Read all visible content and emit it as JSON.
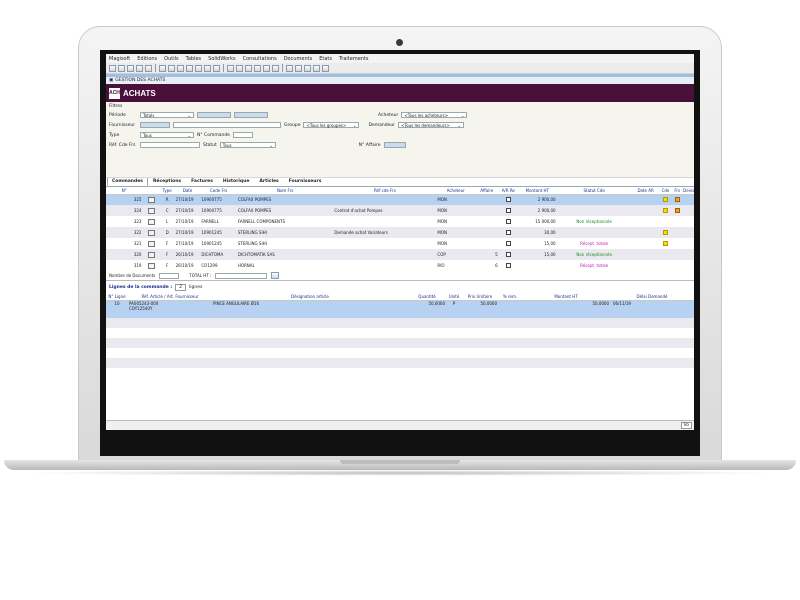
{
  "menu": [
    "Magisoft",
    "Editions",
    "Outils",
    "Tables",
    "SolidWorks",
    "Consultations",
    "Documents",
    "Etats",
    "Traitements"
  ],
  "subbar": {
    "path": "GESTION DES ACHATS"
  },
  "header": {
    "title": "ACHATS",
    "logo": "ACH"
  },
  "filters": {
    "section_label": "Filtres",
    "periode_label": "Période",
    "periode_value": "Totals",
    "fournisseur_label": "Fournisseur",
    "groupe_label": "Groupe",
    "groupe_value": "<Tous les groupes>",
    "acheteur_label": "Acheteur",
    "acheteur_value": "<Tous les acheteurs>",
    "demandeur_label": "Demandeur",
    "demandeur_value": "<Tous les demandeurs>",
    "type_label": "Type",
    "type_value": "Tous",
    "ncommande_label": "N° Commande",
    "refcde_label": "Réf. Cde Frs",
    "statut_label": "Statut",
    "statut_value": "Tous",
    "affaire_label": "N° Affaire"
  },
  "tabs": [
    "Commandes",
    "Réceptions",
    "Factures",
    "Historique",
    "Articles",
    "Fournisseurs"
  ],
  "orders": {
    "columns": [
      "N°",
      "",
      "Type",
      "Date",
      "Code Frs",
      "Nom Frs",
      "Réf cde Frs",
      "Acheteur",
      "Affaire",
      "A/R Re",
      "Montant HT",
      "Statut Cde",
      "Date AR",
      "Cde",
      "Frs",
      "Devis"
    ],
    "rows": [
      {
        "num": "325",
        "type": "R",
        "date": "27/10/19",
        "code": "10900775",
        "nom": "COLFAX POMPES",
        "ref": "",
        "acheteur": "MON",
        "affaire": "",
        "montant": "2 900,00",
        "statut": "",
        "statut_class": "",
        "cde": "y",
        "frs": "o"
      },
      {
        "num": "324",
        "type": "C",
        "date": "27/10/19",
        "code": "10900775",
        "nom": "COLFAX POMPES",
        "ref": "Contrat d'achat Pompes",
        "acheteur": "MON",
        "affaire": "",
        "montant": "2 900,00",
        "statut": "",
        "statut_class": "",
        "cde": "y",
        "frs": "o"
      },
      {
        "num": "323",
        "type": "L",
        "date": "27/10/19",
        "code": "FARNELL",
        "nom": "FARNELL COMPONENTS",
        "ref": "",
        "acheteur": "MON",
        "affaire": "",
        "montant": "15 000,00",
        "statut": "Non réceptionnée",
        "statut_class": "green",
        "cde": "",
        "frs": ""
      },
      {
        "num": "322",
        "type": "D",
        "date": "27/10/19",
        "code": "10901245",
        "nom": "STERLING SIHI",
        "ref": "Demande achat Variateurs",
        "acheteur": "MON",
        "affaire": "",
        "montant": "30,00",
        "statut": "",
        "statut_class": "",
        "cde": "y",
        "frs": ""
      },
      {
        "num": "321",
        "type": "F",
        "date": "27/10/19",
        "code": "10901245",
        "nom": "STERLING SIHI",
        "ref": "",
        "acheteur": "MON",
        "affaire": "",
        "montant": "15,00",
        "statut": "Récept. totale",
        "statut_class": "magenta",
        "cde": "y",
        "frs": ""
      },
      {
        "num": "320",
        "type": "F",
        "date": "26/10/19",
        "code": "DICHTOMA",
        "nom": "DICHTOMATIK SAS",
        "ref": "",
        "acheteur": "COP",
        "affaire": "5",
        "montant": "15,00",
        "statut": "Non réceptionnée",
        "statut_class": "green",
        "cde": "",
        "frs": ""
      },
      {
        "num": "319",
        "type": "F",
        "date": "26/10/19",
        "code": "CO1299",
        "nom": "HORNAL",
        "ref": "",
        "acheteur": "RIO",
        "affaire": "6",
        "montant": "",
        "statut": "Récept. totale",
        "statut_class": "magenta",
        "cde": "",
        "frs": ""
      }
    ]
  },
  "totals": {
    "nombre_label": "Nombre de Documents",
    "total_label": "TOTAL HT :"
  },
  "lignes": {
    "title": "Lignes de la commande :",
    "count": "2",
    "count_suffix": "lignes",
    "columns": [
      "N° Ligne",
      "Réf. Article / Art. Fournisseur",
      "Désignation article",
      "Quantité",
      "Unité",
      "Prix Unitaire",
      "% rem.",
      "Montant HT",
      "Délai Demandé"
    ],
    "rows": [
      {
        "n": "10",
        "ref": "PA005243-000",
        "ref2": "COY12540Y",
        "design": "PINCE ANGULAIRE Ø16",
        "qte": "50,0000",
        "unite": "P",
        "pu": "50,0000",
        "rem": "",
        "montant": "50,0000",
        "delai": "06/11/19"
      }
    ]
  },
  "status": {
    "vo": "Vo"
  }
}
